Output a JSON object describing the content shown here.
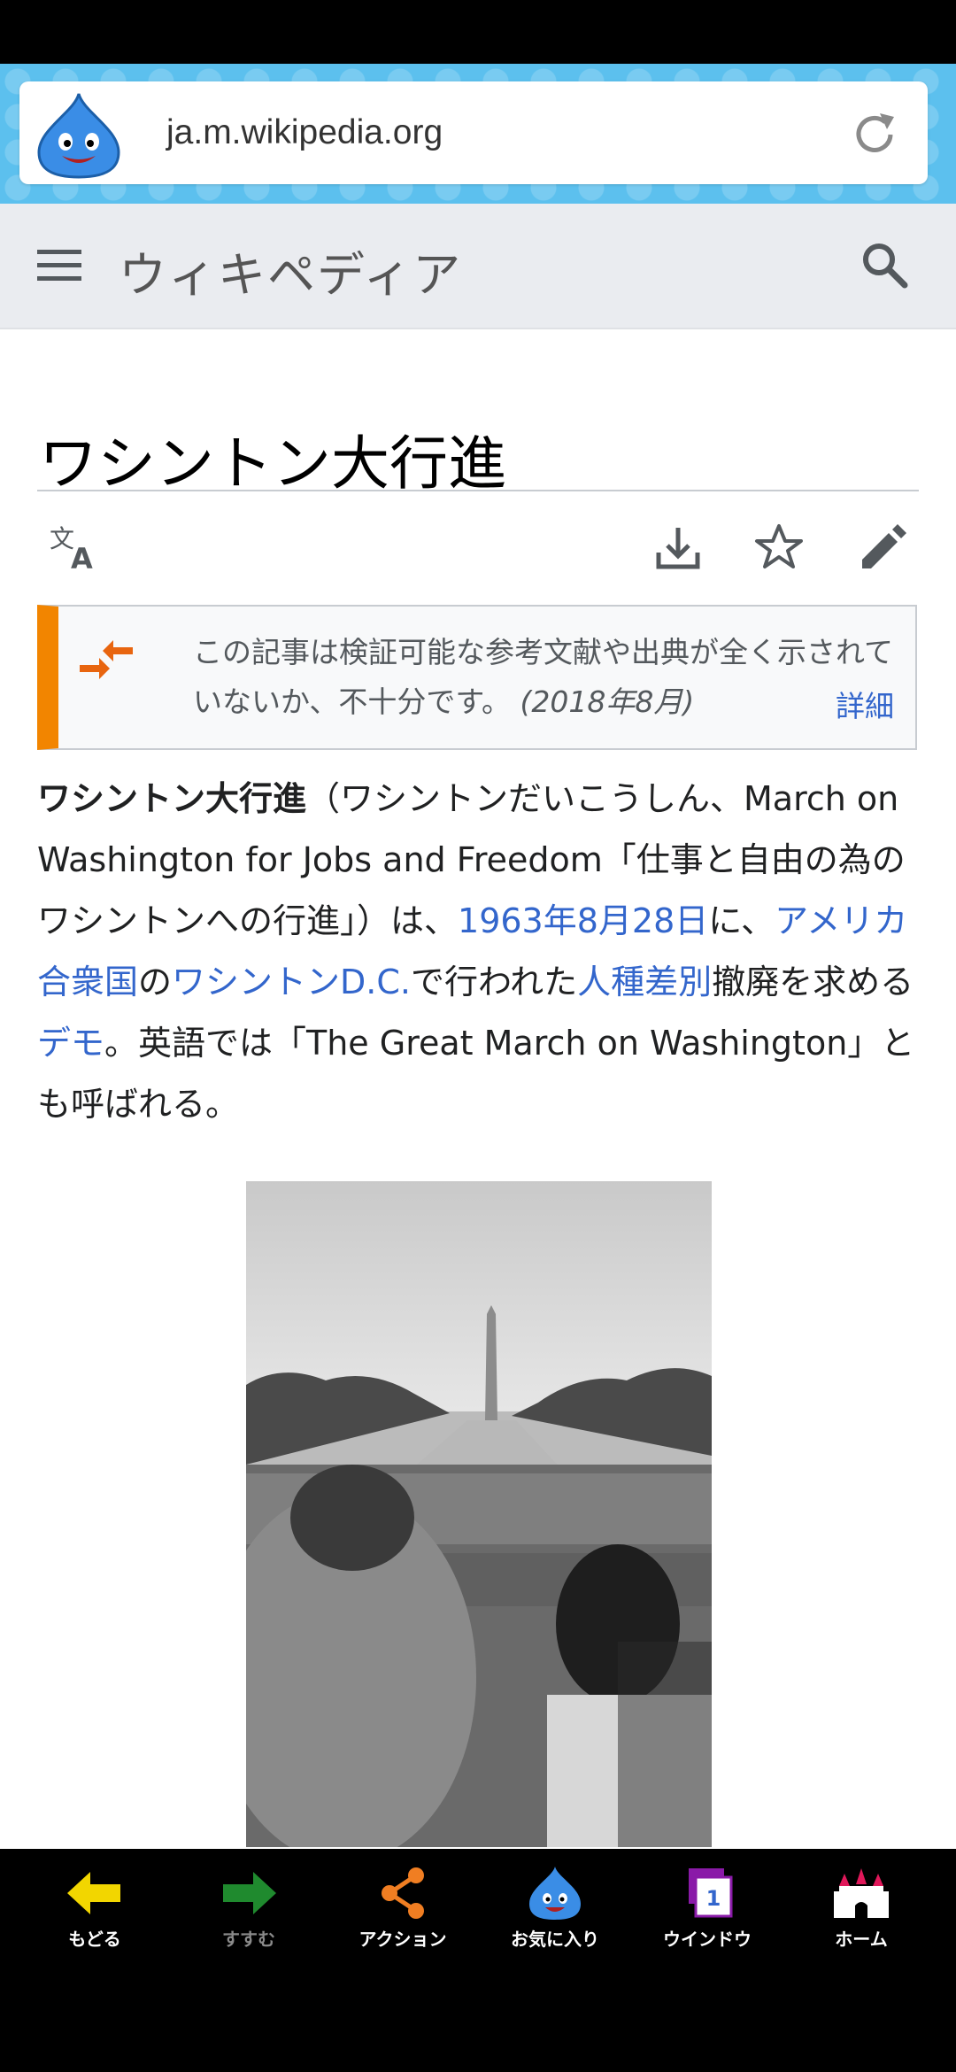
{
  "browser": {
    "url": "ja.m.wikipedia.org"
  },
  "wiki": {
    "logo_text": "ウィキペディア"
  },
  "article": {
    "title": "ワシントン大行進",
    "notice": {
      "text": "この記事は検証可能な参考文献や出典が全く示されていないか、不十分です。",
      "date": "(2018年8月)",
      "link": "詳細"
    },
    "lead": {
      "bold_title": "ワシントン大行進",
      "seg1": "（ワシントンだいこうしん、March on Washington for Jobs and Freedom「仕事と自由の為のワシントンへの行進」）は、",
      "link1": "1963年8月28日",
      "seg2": "に、",
      "link2": "アメリカ合衆国",
      "seg3": "の",
      "link3": "ワシントンD.C.",
      "seg4": "で行われた",
      "link4": "人種差別",
      "seg5": "撤廃を求める",
      "link5": "デモ",
      "seg6": "。英語では「The Great March on Washington」とも呼ばれる。"
    }
  },
  "toolbar": {
    "back": "もどる",
    "forward": "すすむ",
    "action": "アクション",
    "favorite": "お気に入り",
    "window": "ウインドウ",
    "window_count": "1",
    "home": "ホーム"
  },
  "colors": {
    "browser_bar": "#5cc0ee",
    "link": "#3366cc",
    "notice_accent": "#f28500",
    "back_arrow": "#f2d600",
    "forward_arrow": "#1f8a2e",
    "action": "#f07e22"
  },
  "icons": [
    "slime-icon",
    "reload-icon",
    "menu-icon",
    "search-icon",
    "language-icon",
    "download-icon",
    "star-icon",
    "edit-icon",
    "merge-icon",
    "back-arrow-icon",
    "forward-arrow-icon",
    "share-icon",
    "slime-favorite-icon",
    "window-icon",
    "castle-home-icon"
  ]
}
